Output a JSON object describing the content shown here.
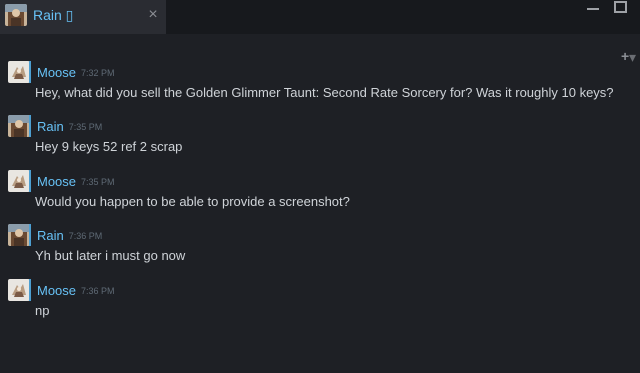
{
  "window": {
    "tab_title": "Rain ▯",
    "tab_close_symbol": "×"
  },
  "toolbar": {
    "add_symbol": "+"
  },
  "messages": [
    {
      "sender": "Moose",
      "time": "7:32 PM",
      "text": "Hey, what did you sell the Golden Glimmer Taunt: Second Rate Sorcery for? Was it roughly 10 keys?",
      "avatar": "moose-avatar"
    },
    {
      "sender": "Rain",
      "time": "7:35 PM",
      "text": "Hey 9 keys 52 ref 2 scrap",
      "avatar": "rain-avatar"
    },
    {
      "sender": "Moose",
      "time": "7:35 PM",
      "text": "Would you happen to be able to provide a screenshot?",
      "avatar": "moose-avatar"
    },
    {
      "sender": "Rain",
      "time": "7:36 PM",
      "text": "Yh but later i must go now",
      "avatar": "rain-avatar"
    },
    {
      "sender": "Moose",
      "time": "7:36 PM",
      "text": "np",
      "avatar": "moose-avatar"
    }
  ],
  "colors": {
    "background": "#1e2025",
    "name": "#67c1f5",
    "message_text": "#cfd3d8",
    "timestamp": "#5f6a75"
  }
}
